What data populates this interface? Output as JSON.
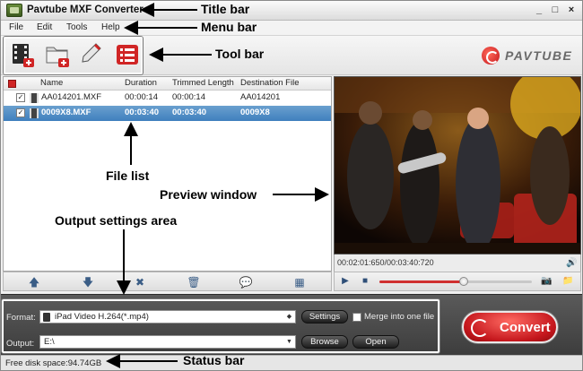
{
  "window": {
    "title": "Pavtube MXF Converter",
    "controls": [
      "_",
      "□",
      "×"
    ]
  },
  "menu": [
    "File",
    "Edit",
    "Tools",
    "Help"
  ],
  "toolbar": {
    "buttons": [
      {
        "name": "add-video",
        "icon": "film-add-icon"
      },
      {
        "name": "add-folder",
        "icon": "folder-add-icon"
      },
      {
        "name": "edit",
        "icon": "pencil-icon"
      },
      {
        "name": "task-list",
        "icon": "list-icon"
      }
    ],
    "brand": "PAVTUBE"
  },
  "file_list": {
    "columns": [
      "Name",
      "Duration",
      "Trimmed Length",
      "Destination File"
    ],
    "rows": [
      {
        "checked": true,
        "name": "AA014201.MXF",
        "duration": "00:00:14",
        "trimmed": "00:00:14",
        "dest": "AA014201",
        "selected": false
      },
      {
        "checked": true,
        "name": "0009X8.MXF",
        "duration": "00:03:40",
        "trimmed": "00:03:40",
        "dest": "0009X8",
        "selected": true
      }
    ]
  },
  "preview": {
    "time": "00:02:01:650/00:03:40:720",
    "progress": 0.55
  },
  "output": {
    "format_label": "Format:",
    "format_value": "iPad Video H.264(*.mp4)",
    "settings_btn": "Settings",
    "merge_label": "Merge into one file",
    "output_label": "Output:",
    "output_value": "E:\\",
    "browse_btn": "Browse",
    "open_btn": "Open",
    "convert_btn": "Convert"
  },
  "status": {
    "text": "Free disk space:94.74GB"
  },
  "annotations": {
    "title_bar": "Title bar",
    "menu_bar": "Menu bar",
    "tool_bar": "Tool bar",
    "file_list": "File list",
    "preview_window": "Preview window",
    "output_settings": "Output settings area",
    "status_bar": "Status bar"
  },
  "colors": {
    "accent_red": "#d02525",
    "selection_blue": "#4a8ac4",
    "settings_dark": "#4a4a4a"
  }
}
